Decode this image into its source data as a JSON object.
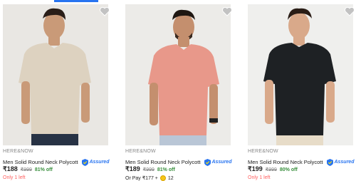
{
  "colors": {
    "brand_blue": "#2874f0",
    "discount_green": "#388e3c",
    "stock_red": "#ff6161",
    "muted": "#878787"
  },
  "products": [
    {
      "brand": "HERE&NOW",
      "title": "Men Solid Round Neck Polycotto...",
      "assured": "Assured",
      "price": "₹188",
      "mrp": "₹999",
      "discount": "81% off",
      "note": "Only 1 left",
      "shirt_color": "#ddd2c0",
      "wishlist_icon": "heart-icon"
    },
    {
      "brand": "HERE&NOW",
      "title": "Men Solid Round Neck Polycotto...",
      "assured": "Assured",
      "price": "₹189",
      "mrp": "₹999",
      "discount": "81% off",
      "pay_text": "Or Pay ₹177 +",
      "coins": "12",
      "shirt_color": "#e8988a",
      "wishlist_icon": "heart-icon"
    },
    {
      "brand": "HERE&NOW",
      "title": "Men Solid Round Neck Polycotto...",
      "assured": "Assured",
      "price": "₹199",
      "mrp": "₹999",
      "discount": "80% off",
      "note": "Only 1 left",
      "shirt_color": "#1e2124",
      "wishlist_icon": "heart-icon"
    }
  ]
}
